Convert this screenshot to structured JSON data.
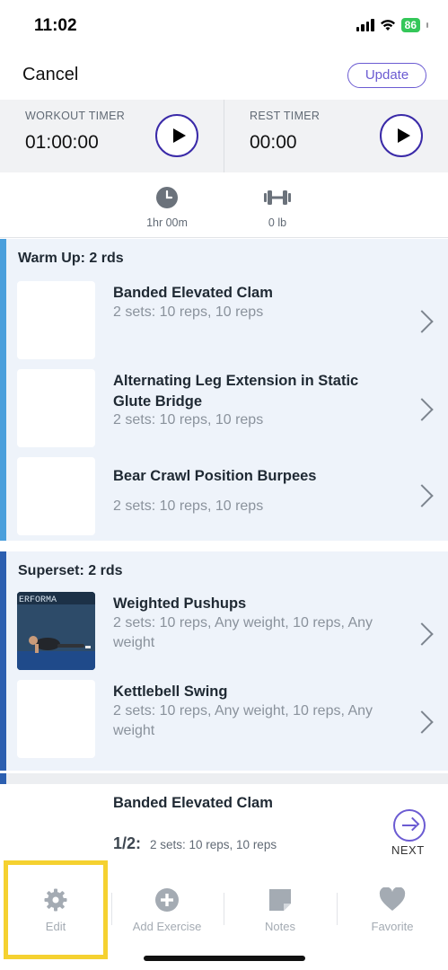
{
  "status_bar": {
    "time": "11:02",
    "battery": "86"
  },
  "header": {
    "cancel_label": "Cancel",
    "update_label": "Update"
  },
  "timers": {
    "workout": {
      "label": "WORKOUT TIMER",
      "value": "01:00:00"
    },
    "rest": {
      "label": "REST TIMER",
      "value": "00:00"
    }
  },
  "stats": {
    "duration": "1hr 00m",
    "weight": "0 lb"
  },
  "sections": [
    {
      "title": "Warm Up: 2 rds",
      "bar_color": "#4a9fdc",
      "exercises": [
        {
          "name": "Banded Elevated Clam",
          "detail": "2 sets: 10 reps, 10 reps"
        },
        {
          "name": "Alternating Leg Extension in Static Glute Bridge",
          "detail": "2 sets: 10 reps, 10 reps"
        },
        {
          "name": "Bear Crawl Position Burpees",
          "detail": "2 sets: 10 reps, 10 reps"
        }
      ]
    },
    {
      "title": "Superset: 2 rds",
      "bar_color": "#2c5fb0",
      "exercises": [
        {
          "name": "Weighted Pushups",
          "detail": "2 sets: 10 reps, Any weight, 10 reps, Any weight",
          "thumb_text": "ERFORMA"
        },
        {
          "name": "Kettlebell Swing",
          "detail": "2 sets: 10 reps, Any weight, 10 reps, Any weight"
        }
      ]
    }
  ],
  "now_playing": {
    "name": "Banded Elevated Clam",
    "counter": "1/2:",
    "detail": "2 sets: 10 reps, 10 reps",
    "next_label": "NEXT"
  },
  "tabbar": {
    "items": [
      {
        "label": "Edit",
        "icon": "gear-icon"
      },
      {
        "label": "Add Exercise",
        "icon": "plus-circle-icon"
      },
      {
        "label": "Notes",
        "icon": "note-icon"
      },
      {
        "label": "Favorite",
        "icon": "heart-icon"
      }
    ]
  },
  "colors": {
    "accent": "#6b5bd2",
    "play_border": "#3a2aa8",
    "highlight": "#f5d130"
  }
}
